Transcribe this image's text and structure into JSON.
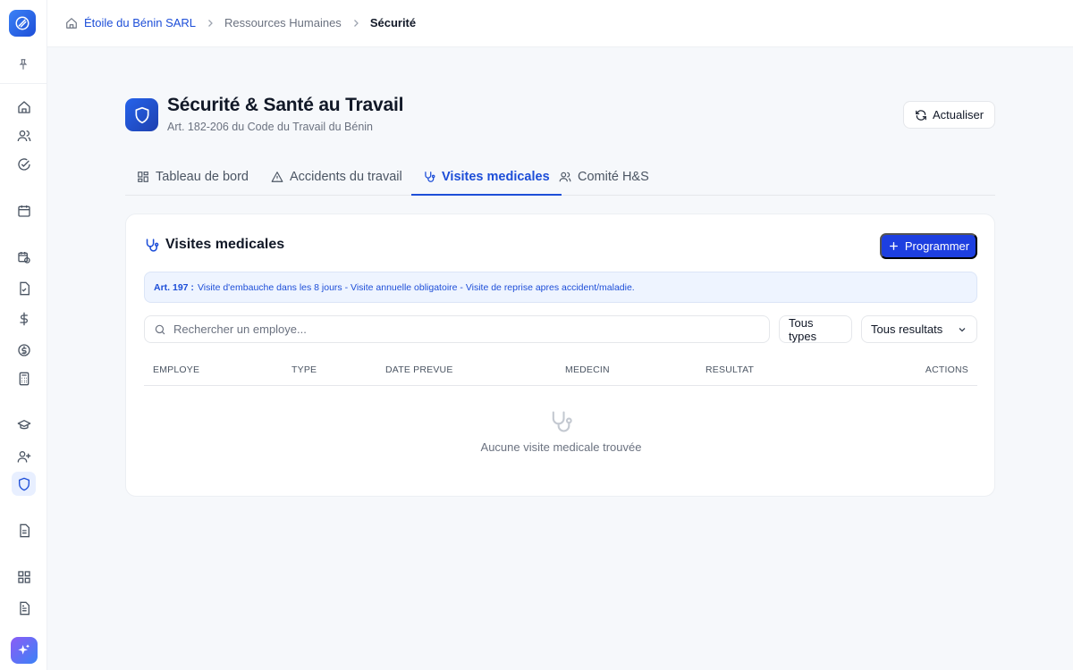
{
  "breadcrumb": {
    "company": "Étoile du Bénin SARL",
    "section": "Ressources Humaines",
    "current": "Sécurité"
  },
  "header": {
    "title": "Sécurité & Santé au Travail",
    "subtitle": "Art. 182-206 du Code du Travail du Bénin",
    "refresh_label": "Actualiser"
  },
  "tabs": [
    {
      "label": "Tableau de bord",
      "icon": "dashboard-icon"
    },
    {
      "label": "Accidents du travail",
      "icon": "warning-icon"
    },
    {
      "label": "Visites medicales",
      "icon": "stethoscope-icon",
      "active": true
    },
    {
      "label": "Comité H&S",
      "icon": "users-icon"
    }
  ],
  "card": {
    "title": "Visites medicales",
    "program_label": "Programmer",
    "info_bold": "Art. 197 :",
    "info_text": "Visite d'embauche dans les 8 jours - Visite annuelle obligatoire - Visite de reprise apres accident/maladie.",
    "search_placeholder": "Rechercher un employe...",
    "filter_type": "Tous types",
    "filter_result": "Tous resultats",
    "columns": [
      "EMPLOYE",
      "TYPE",
      "DATE PREVUE",
      "MEDECIN",
      "RESULTAT",
      "ACTIONS"
    ],
    "empty_text": "Aucune visite medicale trouvée"
  },
  "colors": {
    "accent": "#1d4ed8",
    "primary_button": "#1d3fe0",
    "info_bg": "#eef4ff"
  }
}
